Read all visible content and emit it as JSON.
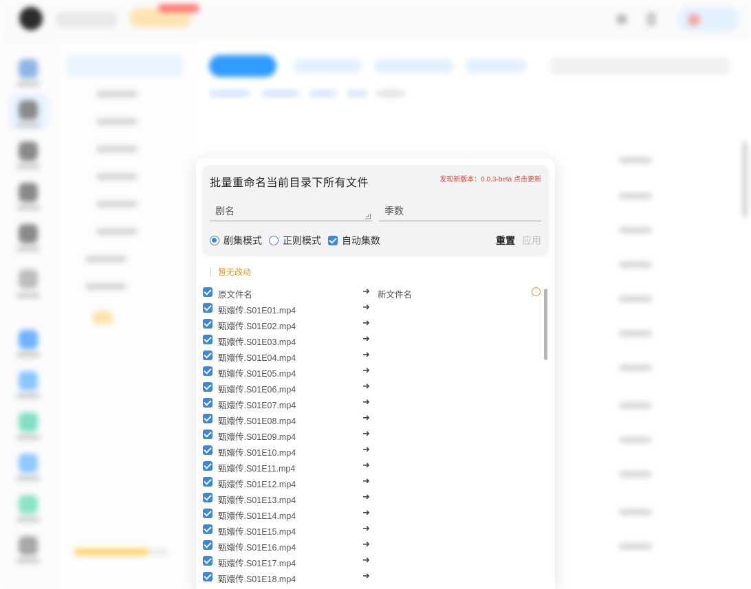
{
  "modal": {
    "title": "批量重命名当前目录下所有文件",
    "version_notice": "发现新版本：0.0.3-beta 点击更新",
    "name_field_label": "剧名",
    "season_field_label": "季数",
    "mode_episode": "剧集模式",
    "mode_regex": "正则模式",
    "auto_episode": "自动集数",
    "reset_label": "重置",
    "apply_label": "应用",
    "status": "暂无改动",
    "header_original": "原文件名",
    "header_new": "新文件名",
    "arrow_glyph": "➜",
    "files": [
      "甄嬛传.S01E01.mp4",
      "甄嬛传.S01E02.mp4",
      "甄嬛传.S01E03.mp4",
      "甄嬛传.S01E04.mp4",
      "甄嬛传.S01E05.mp4",
      "甄嬛传.S01E06.mp4",
      "甄嬛传.S01E07.mp4",
      "甄嬛传.S01E08.mp4",
      "甄嬛传.S01E09.mp4",
      "甄嬛传.S01E10.mp4",
      "甄嬛传.S01E11.mp4",
      "甄嬛传.S01E12.mp4",
      "甄嬛传.S01E13.mp4",
      "甄嬛传.S01E14.mp4",
      "甄嬛传.S01E15.mp4",
      "甄嬛传.S01E16.mp4",
      "甄嬛传.S01E17.mp4",
      "甄嬛传.S01E18.mp4"
    ]
  },
  "colors": {
    "accent": "#3c86e0",
    "version_red": "#e0453a",
    "status_orange": "#e39a1b"
  }
}
